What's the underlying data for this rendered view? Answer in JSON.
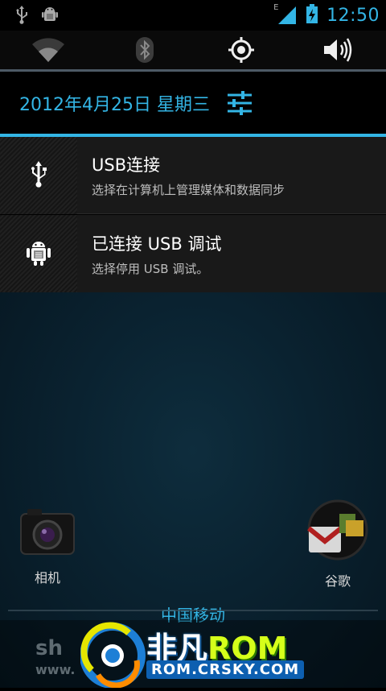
{
  "status_bar": {
    "time": "12:50",
    "network_type": "E",
    "left_icons": [
      "usb-icon",
      "android-debug-icon"
    ],
    "right_icons": [
      "signal-icon",
      "battery-charging-icon"
    ]
  },
  "quick_settings": [
    {
      "name": "wifi-toggle",
      "icon": "wifi-icon",
      "active": false
    },
    {
      "name": "bluetooth-toggle",
      "icon": "bluetooth-icon",
      "active": false
    },
    {
      "name": "gps-toggle",
      "icon": "gps-icon",
      "active": true
    },
    {
      "name": "sound-toggle",
      "icon": "volume-icon",
      "active": false
    }
  ],
  "header": {
    "date": "2012年4月25日 星期三",
    "settings_icon": "settings-sliders-icon"
  },
  "notifications": [
    {
      "title": "USB连接",
      "subtitle": "选择在计算机上管理媒体和数据同步",
      "icon": "usb-icon"
    },
    {
      "title": "已连接 USB 调试",
      "subtitle": "选择停用 USB 调试。",
      "icon": "android-debug-icon"
    }
  ],
  "home": {
    "apps": [
      {
        "label": "相机",
        "icon": "camera-icon"
      },
      {
        "label": "谷歌",
        "icon": "gmail-icon"
      }
    ],
    "carrier": "中国移动"
  },
  "watermark": {
    "logo_main_a": "非凡",
    "logo_main_b": "ROM",
    "logo_sub": "ROM.CRSKY.COM",
    "bg_text_1": "sh",
    "bg_text_2": "www."
  },
  "colors": {
    "accent": "#33b5e5",
    "notification_bg": "#191919"
  }
}
